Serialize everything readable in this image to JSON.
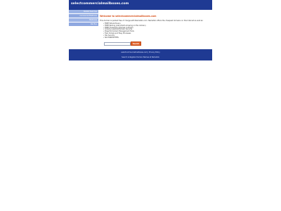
{
  "header": {
    "site_title": "selectcommercialmailboxes.com"
  },
  "sidebar": {
    "items": [
      {
        "label": "Related Searches"
      },
      {
        "label": "Commercial Mailboxes"
      },
      {
        "label": "Mailboxes"
      },
      {
        "label": "Mail Box"
      }
    ]
  },
  "content": {
    "welcome": "Welcome to selectcommercialmailboxes.com",
    "intro": "This domain is parked free of charge with NameSilo.com. NameSilo offers the cheapest domains on the Internet as well as:",
    "features": [
      "FREE WhoIs Privacy",
      "FREE Parking (Like what's showing on this domain)",
      "FREE Forwarding (Domain & Email)",
      "Industry-Leading Domain Security",
      "Powerful Domain Management Tools",
      "Fast, Simple and Easy Processes",
      "SSL Security",
      "NO HIDDEN FEES"
    ]
  },
  "search": {
    "placeholder": "",
    "button_label": "Search"
  },
  "footer": {
    "line1_domain": "selectcommercialmailboxes.com",
    "line1_sep": " | ",
    "line1_privacy": "Privacy Policy",
    "line2": "Search & Register Domain Names at NameSilo"
  },
  "colors": {
    "header_bg": "#1f3a93",
    "welcome_text": "#d9531e",
    "sidebar_bg": "#8fa8e0",
    "search_button_bg": "#e2632a"
  }
}
